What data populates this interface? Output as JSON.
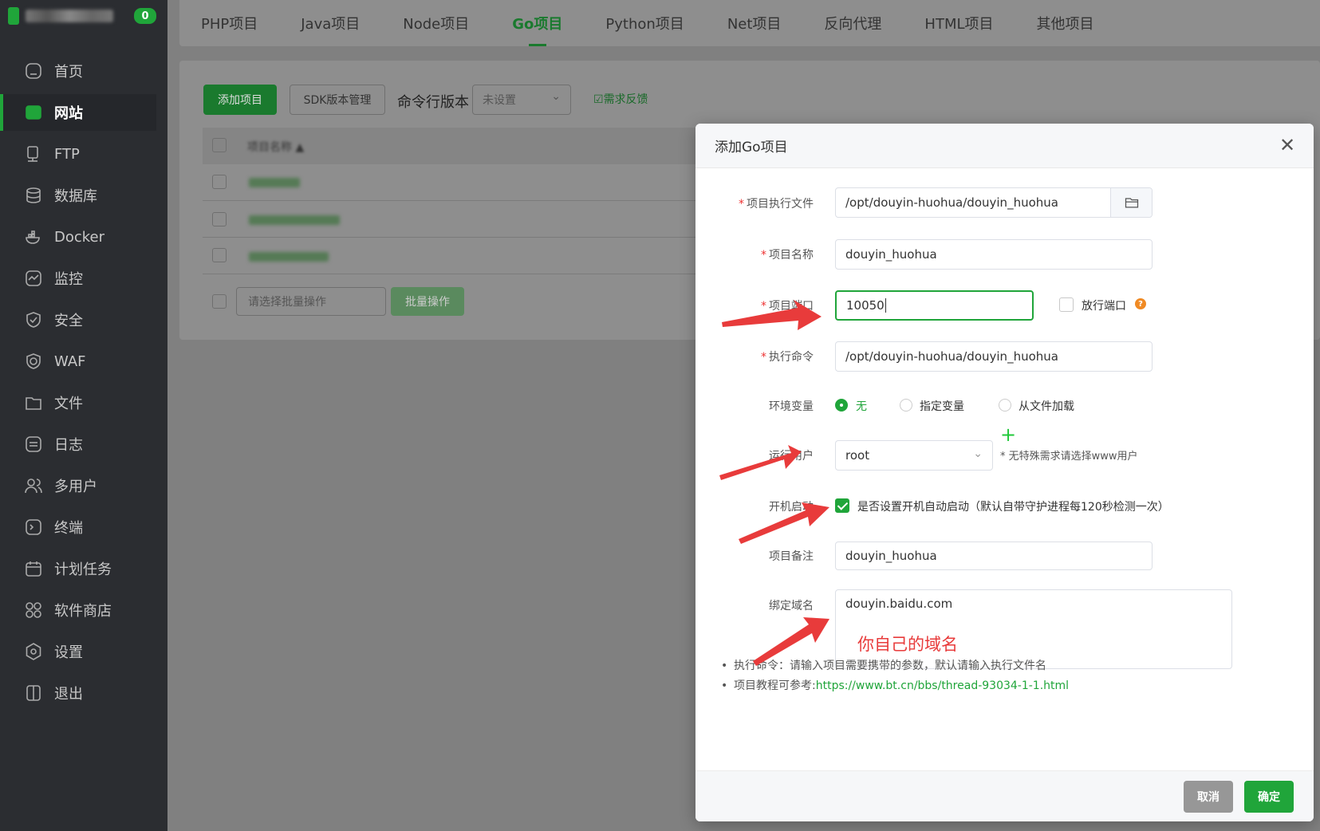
{
  "sidebar": {
    "badge": "0",
    "items": [
      {
        "label": "首页",
        "icon": "home-icon"
      },
      {
        "label": "网站",
        "icon": "globe-icon",
        "active": true
      },
      {
        "label": "FTP",
        "icon": "ftp-icon"
      },
      {
        "label": "数据库",
        "icon": "database-icon"
      },
      {
        "label": "Docker",
        "icon": "docker-icon"
      },
      {
        "label": "监控",
        "icon": "monitor-icon"
      },
      {
        "label": "安全",
        "icon": "shield-icon"
      },
      {
        "label": "WAF",
        "icon": "waf-icon"
      },
      {
        "label": "文件",
        "icon": "folder-icon"
      },
      {
        "label": "日志",
        "icon": "log-icon"
      },
      {
        "label": "多用户",
        "icon": "users-icon"
      },
      {
        "label": "终端",
        "icon": "terminal-icon"
      },
      {
        "label": "计划任务",
        "icon": "calendar-icon"
      },
      {
        "label": "软件商店",
        "icon": "apps-icon"
      },
      {
        "label": "设置",
        "icon": "gear-icon"
      },
      {
        "label": "退出",
        "icon": "logout-icon"
      }
    ]
  },
  "tabs": [
    "PHP项目",
    "Java项目",
    "Node项目",
    "Go项目",
    "Python项目",
    "Net项目",
    "反向代理",
    "HTML项目",
    "其他项目"
  ],
  "active_tab": "Go项目",
  "toolbar": {
    "add_label": "添加项目",
    "sdk_label": "SDK版本管理",
    "cli_label": "命令行版本",
    "cli_select": "未设置",
    "feedback_label": "需求反馈"
  },
  "table": {
    "name_header": "项目名称",
    "batch_select": "请选择批量操作",
    "batch_button": "批量操作"
  },
  "modal": {
    "title": "添加Go项目",
    "fields": {
      "exec_file": {
        "label": "项目执行文件",
        "value": "/opt/douyin-huohua/douyin_huohua"
      },
      "name": {
        "label": "项目名称",
        "value": "douyin_huohua"
      },
      "port": {
        "label": "项目端口",
        "value": "10050",
        "open_port_label": "放行端口"
      },
      "command": {
        "label": "执行命令",
        "value": "/opt/douyin-huohua/douyin_huohua"
      },
      "env": {
        "label": "环境变量",
        "options": [
          "无",
          "指定变量",
          "从文件加载"
        ],
        "selected": "无"
      },
      "run_user": {
        "label": "运行用户",
        "value": "root",
        "hint": "* 无特殊需求请选择www用户"
      },
      "autostart": {
        "label": "开机启动",
        "text": "是否设置开机自动启动（默认自带守护进程每120秒检测一次）",
        "checked": true
      },
      "remark": {
        "label": "项目备注",
        "value": "douyin_huohua"
      },
      "domain": {
        "label": "绑定域名",
        "value": "douyin.baidu.com",
        "annotation": "你自己的域名"
      }
    },
    "tips": [
      {
        "text": "执行命令：请输入项目需要携带的参数，默认请输入执行文件名"
      },
      {
        "text": "项目教程可参考:",
        "link": "https://www.bt.cn/bbs/thread-93034-1-1.html"
      }
    ],
    "cancel_label": "取消",
    "ok_label": "确定"
  },
  "colors": {
    "accent": "#20a53a",
    "sidebar_bg": "#2b2d31",
    "annotation_red": "#e83b3b"
  }
}
